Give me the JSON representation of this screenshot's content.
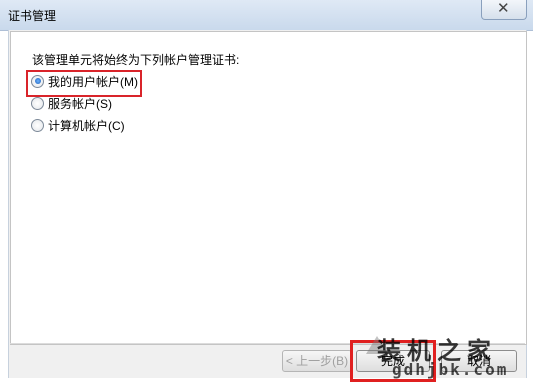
{
  "window": {
    "title": "证书管理",
    "close_glyph": "✕"
  },
  "prompt": "该管理单元将始终为下列帐户管理证书:",
  "options": [
    {
      "label": "我的用户帐户(M)",
      "checked": true
    },
    {
      "label": "服务帐户(S)",
      "checked": false
    },
    {
      "label": "计算机帐户(C)",
      "checked": false
    }
  ],
  "buttons": {
    "back": "< 上一步(B)",
    "finish": "完成",
    "cancel": "取消"
  },
  "watermark": {
    "text": "装机之家",
    "url": "gdhjbk.com"
  },
  "colors": {
    "highlight_box": "#e02020",
    "title_bar": "#dfe9f5"
  }
}
